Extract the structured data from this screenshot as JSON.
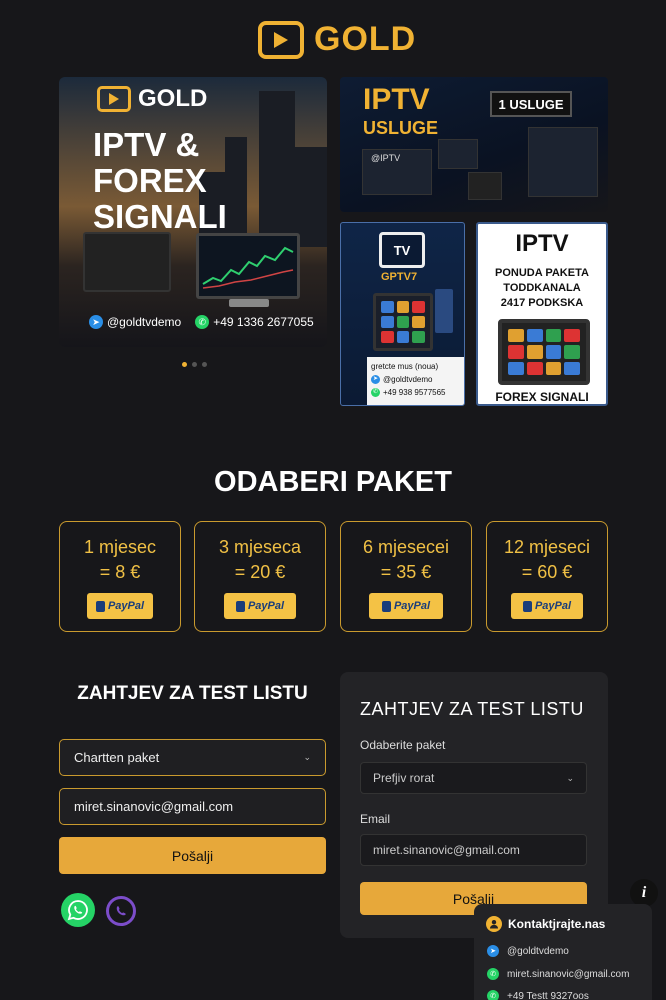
{
  "brand": {
    "name": "GOLD"
  },
  "hero": {
    "logo_text": "GOLD",
    "title": "IPTV & FOREX SIGNALI",
    "telegram": "@goldtvdemo",
    "phone": "+49 1336 2677055"
  },
  "promo1": {
    "line1": "IPTV",
    "line2": "USLUGE",
    "badge": "1 USLUGE",
    "handle": "@IPTV"
  },
  "promo2": {
    "icon": "TV",
    "title": "GPTV7",
    "caption": "gretcte mus (noua)",
    "handle": "@goldtvdemo",
    "phone": "+49 938 9577565"
  },
  "promo3": {
    "title": "IPTV",
    "line1": "PONUDA PAKETA",
    "line2": "TODDKANALA",
    "line3": "2417 PODKSKA",
    "footer": "FOREX SIGNALI"
  },
  "packages_title": "ODABERI PAKET",
  "packages": [
    {
      "period": "1 mjesec",
      "price": "= 8 €",
      "pay": "PayPal"
    },
    {
      "period": "3 mjeseca",
      "price": "= 20 €",
      "pay": "PayPal"
    },
    {
      "period": "6 mjesecei",
      "price": "= 35 €",
      "pay": "PayPal"
    },
    {
      "period": "12 mjeseci",
      "price": "= 60 €",
      "pay": "PayPal"
    }
  ],
  "form_left": {
    "title": "ZAHTJEV ZA TEST LISTU",
    "select_value": "Chartten paket",
    "email_value": "miret.sinanovic@gmail.com",
    "submit": "Pošalji"
  },
  "form_right": {
    "title": "ZAHTJEV ZA TEST LISTU",
    "package_label": "Odaberite paket",
    "package_value": "Prefjiv rorat",
    "email_label": "Email",
    "email_value": "miret.sinanovic@gmail.com",
    "submit": "Pošalji"
  },
  "contact": {
    "title": "Kontaktjrajte.nas",
    "telegram": "@goldtvdemo",
    "email": "miret.sinanovic@gmail.com",
    "phone": "+49 Testt 9327oos"
  },
  "colors": {
    "gold": "#f0b233",
    "background": "#17171a",
    "paypal_blue": "#1a3d7a",
    "whatsapp": "#25d366",
    "viber": "#7c4dca",
    "telegram": "#2a8ee6"
  },
  "icons": [
    "play-icon",
    "telegram-icon",
    "whatsapp-icon",
    "viber-icon",
    "info-icon",
    "user-icon",
    "chevron-down-icon"
  ]
}
